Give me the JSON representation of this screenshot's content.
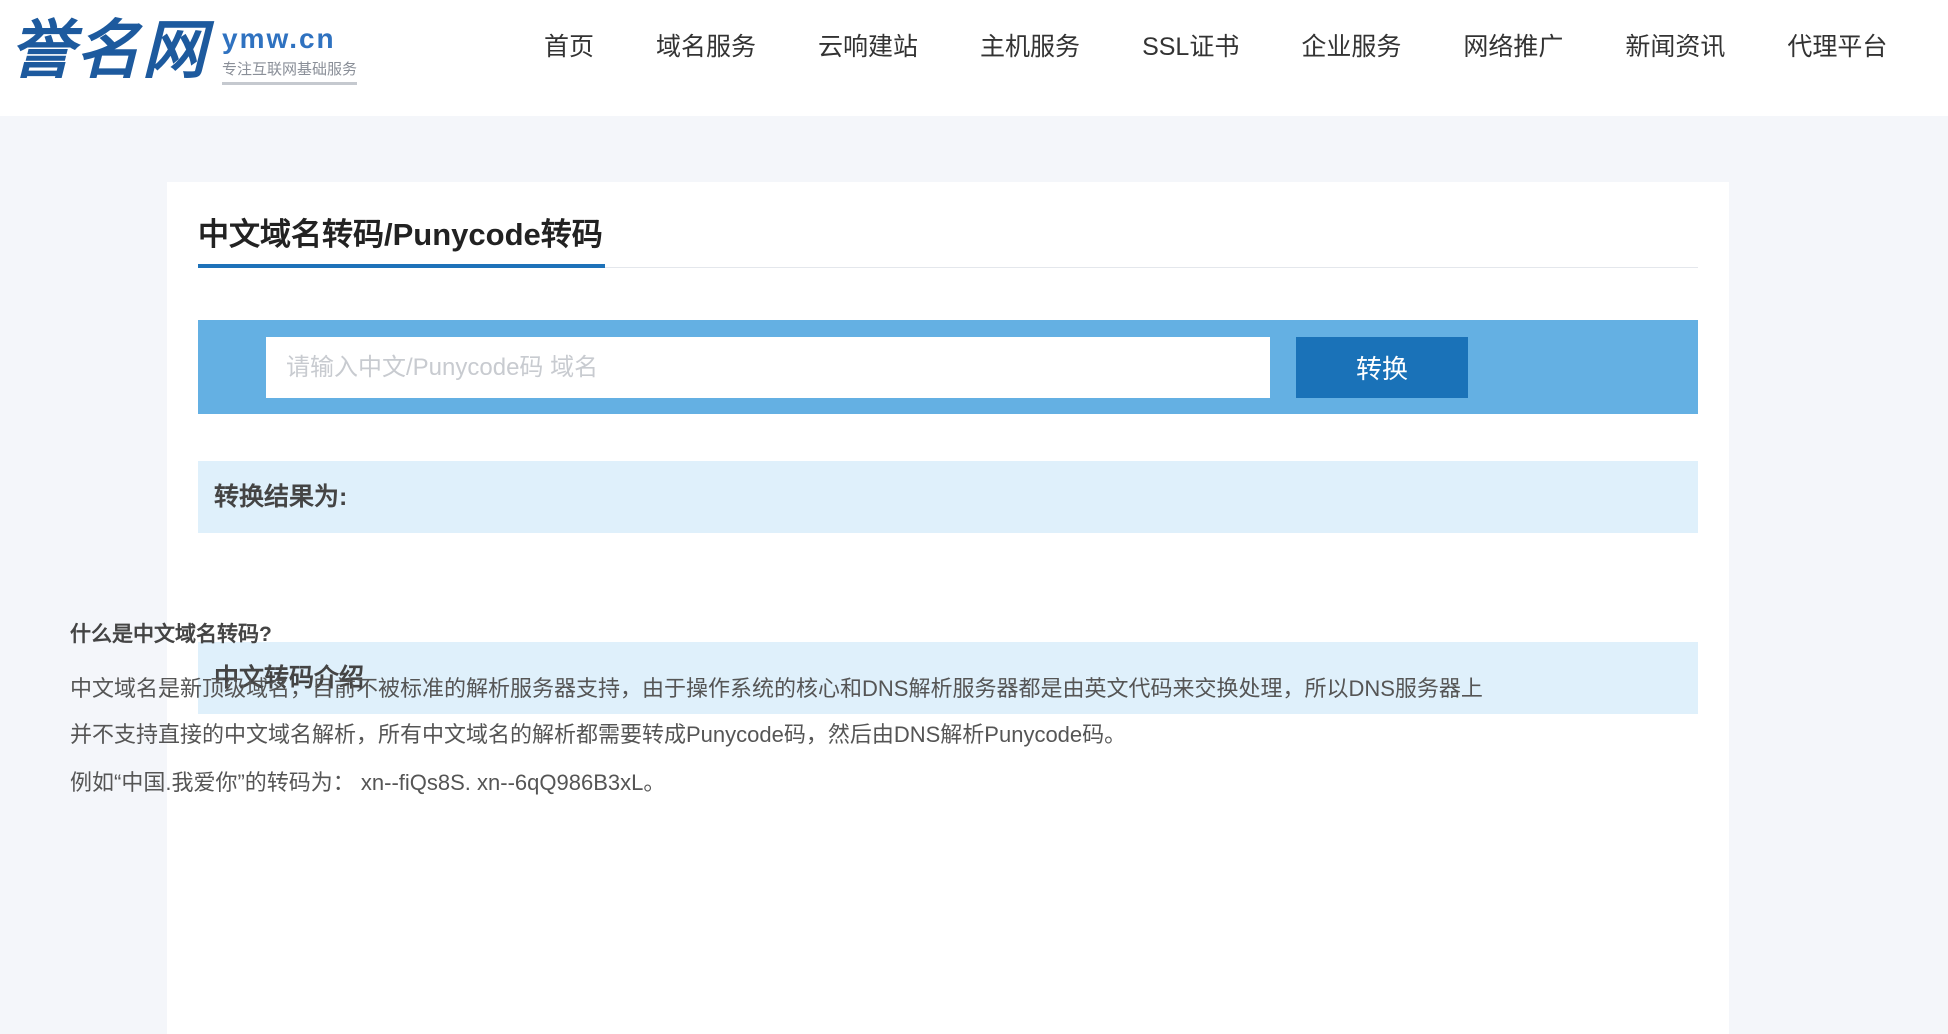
{
  "brand": {
    "logo_cn": "誉名网",
    "logo_en": "ymw.cn",
    "slogan": "专注互联网基础服务"
  },
  "nav": {
    "items": [
      {
        "label": "首页"
      },
      {
        "label": "域名服务"
      },
      {
        "label": "云响建站"
      },
      {
        "label": "主机服务"
      },
      {
        "label": "SSL证书"
      },
      {
        "label": "企业服务"
      },
      {
        "label": "网络推广"
      },
      {
        "label": "新闻资讯"
      },
      {
        "label": "代理平台"
      }
    ]
  },
  "page": {
    "title": "中文域名转码/Punycode转码"
  },
  "converter": {
    "input_value": "",
    "input_placeholder": "请输入中文/Punycode码 域名",
    "button_label": "转换"
  },
  "result": {
    "label": "转换结果为:"
  },
  "intro": {
    "heading": "中文转码介绍",
    "question": "什么是中文域名转码?",
    "paragraph": "中文域名是新顶级域名，目前不被标准的解析服务器支持，由于操作系统的核心和DNS解析服务器都是由英文代码来交换处理，所以DNS服务器上并不支持直接的中文域名解析，所有中文域名的解析都需要转成Punycode码，然后由DNS解析Punycode码。",
    "example": "例如“中国.我爱你”的转码为： xn--fiQs8S. xn--6qQ986B3xL。"
  },
  "colors": {
    "brand_blue": "#1d5a9e",
    "bar_blue": "#64b0e3",
    "button_blue": "#1a72b8",
    "section_bg": "#dff0fb",
    "page_bg": "#f4f6fa"
  }
}
